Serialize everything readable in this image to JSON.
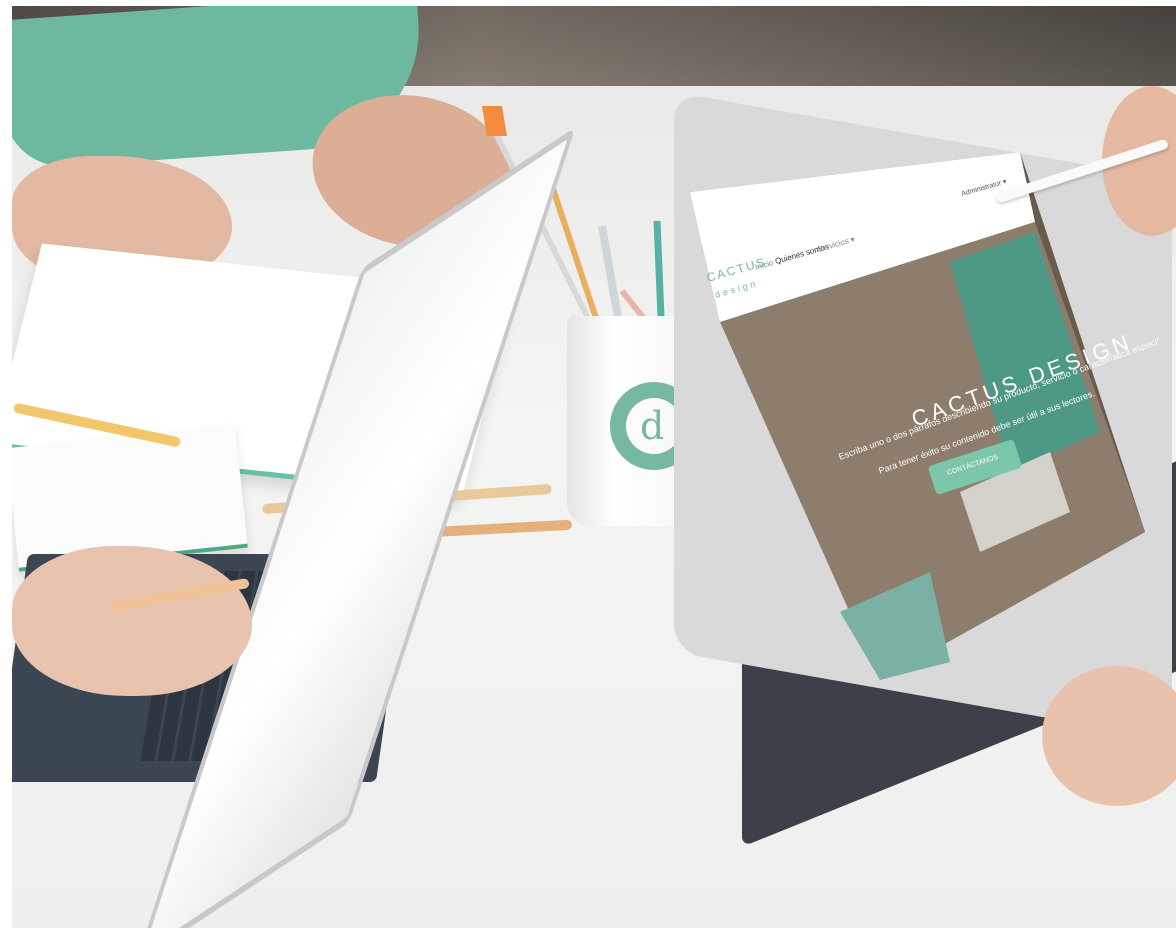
{
  "tablet_site": {
    "logo_line1": "CACTUS",
    "logo_line2": "design",
    "nav": [
      "Inicio",
      "Quienes somos",
      "Servicios ▾"
    ],
    "admin": "Administrator ▾",
    "hero_title": "CACTUS DESIGN",
    "hero_text_line1": "Escriba uno o dos párrafos describiendo su producto, servicio o característica específica.",
    "hero_text_line2": "Para tener éxito su contenido debe ser útil a sus lectores.",
    "cta_label": "CONTÁCTANOS"
  },
  "cup_logo_letter": "d",
  "colors": {
    "accent": "#76b8a1",
    "cta": "#7cc7a9",
    "screen_bg": "#ffffff",
    "tablet_frame": "#d9d9d9",
    "keyboard": "#3c4653"
  }
}
